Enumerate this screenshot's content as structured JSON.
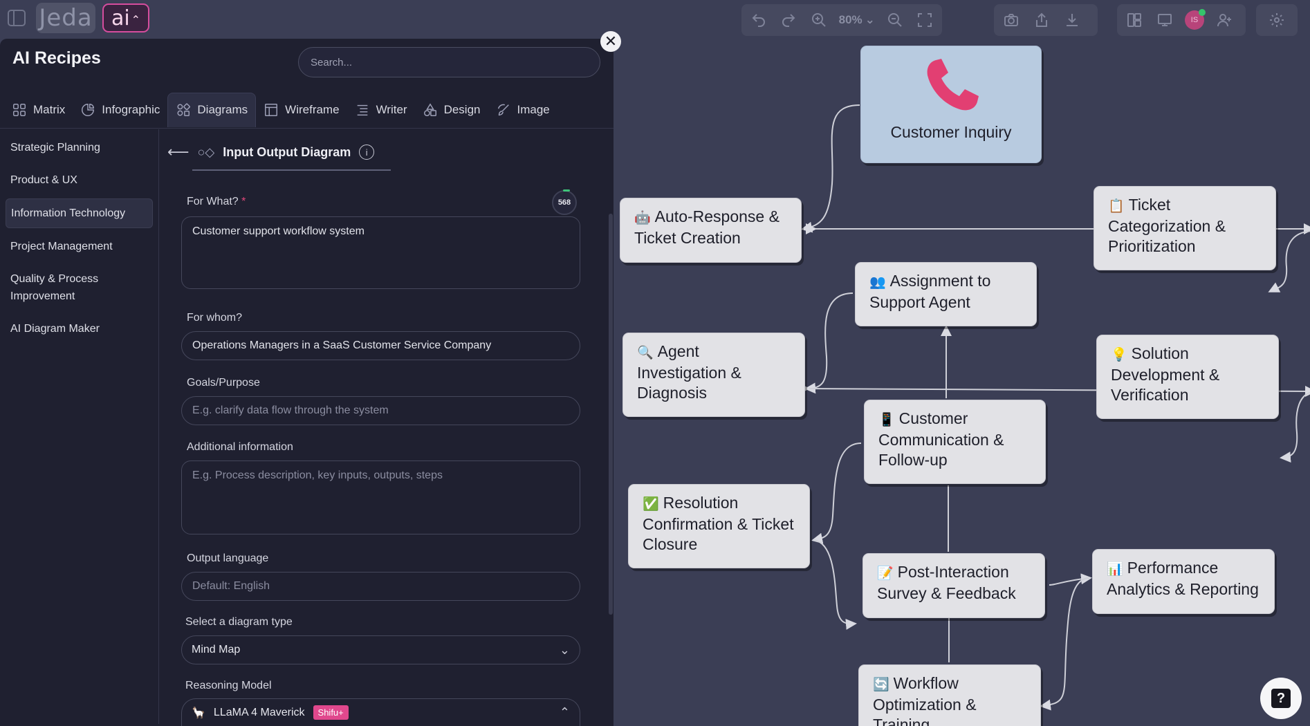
{
  "app": {
    "logo": "Jeda",
    "ai_label": "ai"
  },
  "toolbar": {
    "zoom": "80%"
  },
  "panel": {
    "title": "AI Recipes",
    "search_placeholder": "Search...",
    "tabs": [
      "Matrix",
      "Infographic",
      "Diagrams",
      "Wireframe",
      "Writer",
      "Design",
      "Image"
    ],
    "active_tab": "Diagrams",
    "categories": [
      "Strategic Planning",
      "Product & UX",
      "Information Technology",
      "Project Management",
      "Quality & Process Improvement",
      "AI Diagram Maker"
    ],
    "active_category": "Information Technology"
  },
  "form": {
    "title": "Input Output Diagram",
    "for_what_label": "For What?",
    "required_mark": "*",
    "counter": "568",
    "for_what_value": "Customer support workflow system",
    "for_whom_label": "For whom?",
    "for_whom_value": "Operations Managers in a SaaS Customer Service Company",
    "goals_label": "Goals/Purpose",
    "goals_placeholder": "E.g. clarify data flow through the system",
    "additional_label": "Additional information",
    "additional_placeholder": "E.g. Process description, key inputs, outputs, steps",
    "language_label": "Output language",
    "language_placeholder": "Default: English",
    "diagram_type_label": "Select a diagram type",
    "diagram_type_value": "Mind Map",
    "model_label": "Reasoning Model",
    "model_value": "LLaMA 4 Maverick",
    "model_badge": "Shifu+"
  },
  "diagram": {
    "root": "Customer Inquiry",
    "nodes": {
      "auto_response": "Auto-Response & Ticket Creation",
      "ticket_cat": "Ticket Categorization & Prioritization",
      "assignment": "Assignment to Support Agent",
      "investigation": "Agent Investigation & Diagnosis",
      "solution": "Solution Development & Verification",
      "communication": "Customer Communication & Follow-up",
      "resolution": "Resolution Confirmation & Ticket Closure",
      "survey": "Post-Interaction Survey & Feedback",
      "analytics": "Performance Analytics & Reporting",
      "workflow": "Workflow Optimization & Training"
    }
  },
  "help": {
    "label": "?"
  }
}
